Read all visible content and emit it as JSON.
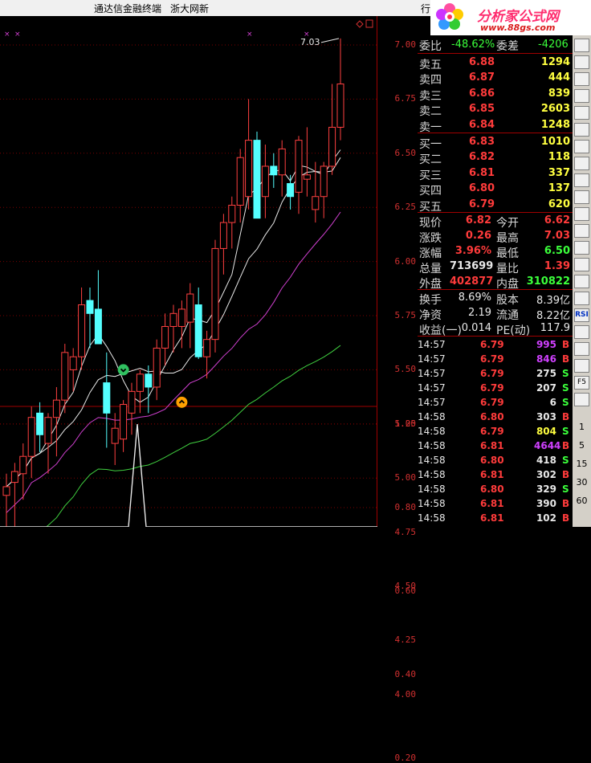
{
  "title_bar": {
    "app_name": "通达信金融终端",
    "site_name": "浙大网新",
    "tab_label": "行"
  },
  "logo": {
    "name": "分析家公式网",
    "url_text": "www.88gs.com"
  },
  "chart": {
    "y_axis_ticks": [
      "7.00",
      "6.75",
      "6.50",
      "6.25",
      "6.00",
      "5.75",
      "5.50",
      "5.25",
      "5.00",
      "4.75",
      "4.50",
      "4.25",
      "4.00"
    ],
    "high_label": "7.03",
    "indicator_ticks": [
      "1.00",
      "0.80",
      "0.60",
      "0.40",
      "0.20"
    ],
    "candles": [
      {
        "o": 4.92,
        "h": 5.02,
        "l": 4.68,
        "c": 4.96
      },
      {
        "o": 4.98,
        "h": 5.07,
        "l": 4.74,
        "c": 5.03
      },
      {
        "o": 5.02,
        "h": 5.16,
        "l": 4.9,
        "c": 5.1
      },
      {
        "o": 5.1,
        "h": 5.33,
        "l": 5.0,
        "c": 5.28
      },
      {
        "o": 5.3,
        "h": 5.35,
        "l": 5.12,
        "c": 5.2
      },
      {
        "o": 5.16,
        "h": 5.3,
        "l": 5.02,
        "c": 5.28
      },
      {
        "o": 5.28,
        "h": 5.42,
        "l": 5.1,
        "c": 5.36
      },
      {
        "o": 5.36,
        "h": 5.62,
        "l": 5.3,
        "c": 5.58
      },
      {
        "o": 5.5,
        "h": 5.6,
        "l": 5.4,
        "c": 5.56
      },
      {
        "o": 5.56,
        "h": 5.88,
        "l": 5.5,
        "c": 5.8
      },
      {
        "o": 5.82,
        "h": 5.88,
        "l": 5.6,
        "c": 5.76
      },
      {
        "o": 5.78,
        "h": 5.96,
        "l": 5.68,
        "c": 5.62
      },
      {
        "o": 5.44,
        "h": 5.58,
        "l": 5.14,
        "c": 5.3
      },
      {
        "o": 5.16,
        "h": 5.3,
        "l": 5.06,
        "c": 5.23
      },
      {
        "o": 5.18,
        "h": 5.36,
        "l": 5.12,
        "c": 5.34
      },
      {
        "o": 5.3,
        "h": 5.44,
        "l": 5.2,
        "c": 5.4
      },
      {
        "o": 5.4,
        "h": 5.5,
        "l": 5.3,
        "c": 5.48
      },
      {
        "o": 5.48,
        "h": 5.52,
        "l": 5.3,
        "c": 5.42
      },
      {
        "o": 5.42,
        "h": 5.64,
        "l": 5.36,
        "c": 5.6
      },
      {
        "o": 5.6,
        "h": 5.76,
        "l": 5.52,
        "c": 5.7
      },
      {
        "o": 5.7,
        "h": 5.8,
        "l": 5.58,
        "c": 5.76
      },
      {
        "o": 5.7,
        "h": 5.82,
        "l": 5.6,
        "c": 5.78
      },
      {
        "o": 5.72,
        "h": 5.9,
        "l": 5.6,
        "c": 5.85
      },
      {
        "o": 5.8,
        "h": 5.88,
        "l": 5.55,
        "c": 5.56
      },
      {
        "o": 5.56,
        "h": 5.68,
        "l": 5.46,
        "c": 5.64
      },
      {
        "o": 5.64,
        "h": 6.1,
        "l": 5.58,
        "c": 6.06
      },
      {
        "o": 6.06,
        "h": 6.22,
        "l": 5.94,
        "c": 6.18
      },
      {
        "o": 6.18,
        "h": 6.3,
        "l": 6.06,
        "c": 6.26
      },
      {
        "o": 6.26,
        "h": 6.52,
        "l": 6.18,
        "c": 6.48
      },
      {
        "o": 6.3,
        "h": 6.75,
        "l": 6.24,
        "c": 6.56
      },
      {
        "o": 6.56,
        "h": 6.6,
        "l": 6.3,
        "c": 6.2
      },
      {
        "o": 6.3,
        "h": 6.54,
        "l": 6.2,
        "c": 6.44
      },
      {
        "o": 6.44,
        "h": 6.5,
        "l": 6.34,
        "c": 6.4
      },
      {
        "o": 6.4,
        "h": 6.56,
        "l": 6.3,
        "c": 6.52
      },
      {
        "o": 6.36,
        "h": 6.4,
        "l": 6.24,
        "c": 6.3
      },
      {
        "o": 6.32,
        "h": 6.58,
        "l": 6.22,
        "c": 6.56
      },
      {
        "o": 6.38,
        "h": 6.62,
        "l": 6.3,
        "c": 6.4
      },
      {
        "o": 6.24,
        "h": 6.46,
        "l": 6.18,
        "c": 6.3
      },
      {
        "o": 6.3,
        "h": 6.46,
        "l": 6.2,
        "c": 6.44
      },
      {
        "o": 6.44,
        "h": 6.82,
        "l": 6.4,
        "c": 6.62
      },
      {
        "o": 6.62,
        "h": 7.03,
        "l": 6.56,
        "c": 6.82
      }
    ]
  },
  "quote": {
    "weibi": {
      "label": "委比",
      "value": "-48.62%",
      "label2": "委差",
      "value2": "-4206"
    },
    "asks": [
      {
        "label": "卖五",
        "price": "6.88",
        "vol": "1294"
      },
      {
        "label": "卖四",
        "price": "6.87",
        "vol": "444"
      },
      {
        "label": "卖三",
        "price": "6.86",
        "vol": "839"
      },
      {
        "label": "卖二",
        "price": "6.85",
        "vol": "2603"
      },
      {
        "label": "卖一",
        "price": "6.84",
        "vol": "1248"
      }
    ],
    "bids": [
      {
        "label": "买一",
        "price": "6.83",
        "vol": "1010"
      },
      {
        "label": "买二",
        "price": "6.82",
        "vol": "118"
      },
      {
        "label": "买三",
        "price": "6.81",
        "vol": "337"
      },
      {
        "label": "买四",
        "price": "6.80",
        "vol": "137"
      },
      {
        "label": "买五",
        "price": "6.79",
        "vol": "620"
      }
    ],
    "stats": [
      {
        "l1": "现价",
        "v1": "6.82",
        "c1": "red",
        "l2": "今开",
        "v2": "6.62",
        "c2": "red"
      },
      {
        "l1": "涨跌",
        "v1": "0.26",
        "c1": "red",
        "l2": "最高",
        "v2": "7.03",
        "c2": "red"
      },
      {
        "l1": "涨幅",
        "v1": "3.96%",
        "c1": "red",
        "l2": "最低",
        "v2": "6.50",
        "c2": "green"
      },
      {
        "l1": "总量",
        "v1": "713699",
        "c1": "white",
        "l2": "量比",
        "v2": "1.39",
        "c2": "red"
      },
      {
        "l1": "外盘",
        "v1": "402877",
        "c1": "red",
        "l2": "内盘",
        "v2": "310822",
        "c2": "green"
      }
    ],
    "finance": [
      {
        "l1": "换手",
        "v1": "8.69%",
        "l2": "股本",
        "v2": "8.39亿"
      },
      {
        "l1": "净资",
        "v1": "2.19",
        "l2": "流通",
        "v2": "8.22亿"
      },
      {
        "l1": "收益(一)",
        "v1": "0.014",
        "l2": "PE(动)",
        "v2": "117.9"
      }
    ],
    "ticks": [
      {
        "time": "14:57",
        "price": "6.79",
        "vol": "995",
        "flag": "B",
        "vc": "purple"
      },
      {
        "time": "14:57",
        "price": "6.79",
        "vol": "846",
        "flag": "B",
        "vc": "purple"
      },
      {
        "time": "14:57",
        "price": "6.79",
        "vol": "275",
        "flag": "S",
        "vc": "white"
      },
      {
        "time": "14:57",
        "price": "6.79",
        "vol": "207",
        "flag": "S",
        "vc": "white"
      },
      {
        "time": "14:57",
        "price": "6.79",
        "vol": "6",
        "flag": "S",
        "vc": "white"
      },
      {
        "time": "14:58",
        "price": "6.80",
        "vol": "303",
        "flag": "B",
        "vc": "white"
      },
      {
        "time": "14:58",
        "price": "6.79",
        "vol": "804",
        "flag": "S",
        "vc": "yel"
      },
      {
        "time": "14:58",
        "price": "6.81",
        "vol": "4644",
        "flag": "B",
        "vc": "purple"
      },
      {
        "time": "14:58",
        "price": "6.80",
        "vol": "418",
        "flag": "S",
        "vc": "white"
      },
      {
        "time": "14:58",
        "price": "6.81",
        "vol": "302",
        "flag": "B",
        "vc": "white"
      },
      {
        "time": "14:58",
        "price": "6.80",
        "vol": "329",
        "flag": "S",
        "vc": "white"
      },
      {
        "time": "14:58",
        "price": "6.81",
        "vol": "390",
        "flag": "B",
        "vc": "white"
      },
      {
        "time": "14:58",
        "price": "6.81",
        "vol": "102",
        "flag": "B",
        "vc": "white"
      }
    ]
  },
  "toolbar": {
    "buttons": [
      "RSI",
      "F5"
    ],
    "numbers": [
      "1",
      "5",
      "15",
      "30",
      "60"
    ]
  }
}
